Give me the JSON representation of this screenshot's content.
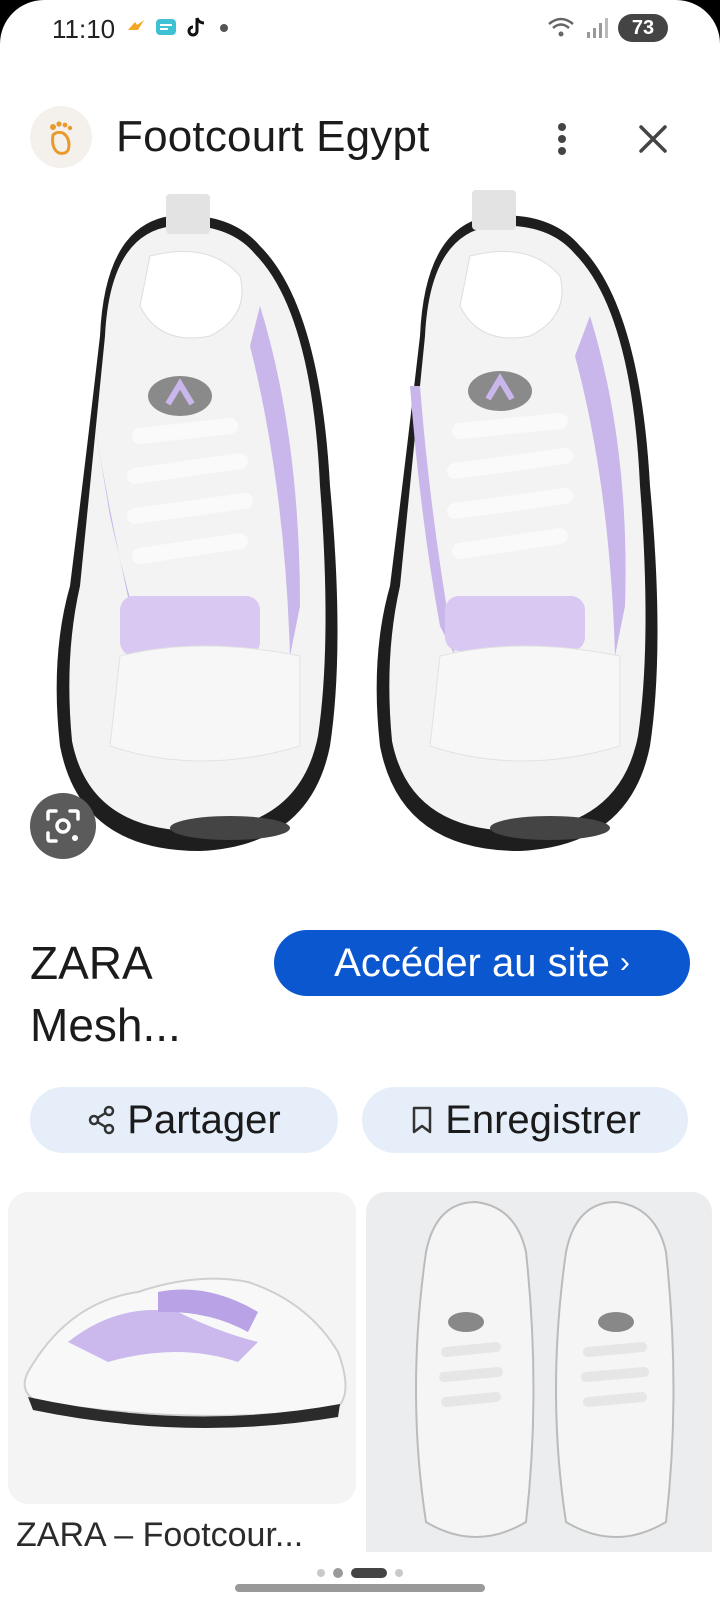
{
  "status_bar": {
    "time": "11:10",
    "icons": [
      "weather-icon",
      "chat-icon",
      "tiktok-icon",
      "notification-dot"
    ],
    "battery": "73",
    "signal_icons": [
      "wifi-icon",
      "signal-icon"
    ]
  },
  "header": {
    "site_name": "Footcourt Egypt",
    "icons": [
      "site-logo",
      "more-vert-icon",
      "close-icon"
    ]
  },
  "product": {
    "title": "ZARA Mesh...",
    "visit_label": "Accéder au site",
    "visit_chevron": "›"
  },
  "actions": {
    "share_label": "Partager",
    "save_label": "Enregistrer"
  },
  "related": [
    {
      "caption": "ZARA – Footcour..."
    },
    {
      "caption": ""
    }
  ],
  "colors": {
    "accent": "#0b57d0",
    "chip_bg": "#e6eefa",
    "shoe_lilac": "#c9b6ea"
  }
}
